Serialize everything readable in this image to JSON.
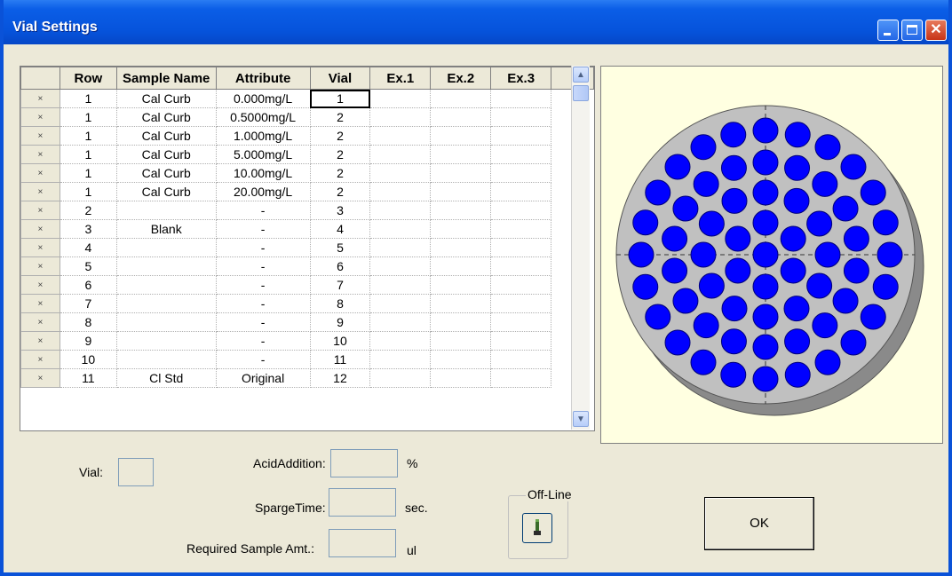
{
  "window": {
    "title": "Vial Settings"
  },
  "grid": {
    "columns": [
      "Row",
      "Sample Name",
      "Attribute",
      "Vial",
      "Ex.1",
      "Ex.2",
      "Ex.3"
    ],
    "row_marker": "×",
    "rows": [
      {
        "row": "1",
        "sample": "Cal Curb",
        "attr": "0.000mg/L",
        "vial": "1",
        "ex1": "",
        "ex2": "",
        "ex3": ""
      },
      {
        "row": "1",
        "sample": "Cal Curb",
        "attr": "0.5000mg/L",
        "vial": "2",
        "ex1": "",
        "ex2": "",
        "ex3": ""
      },
      {
        "row": "1",
        "sample": "Cal Curb",
        "attr": "1.000mg/L",
        "vial": "2",
        "ex1": "",
        "ex2": "",
        "ex3": ""
      },
      {
        "row": "1",
        "sample": "Cal Curb",
        "attr": "5.000mg/L",
        "vial": "2",
        "ex1": "",
        "ex2": "",
        "ex3": ""
      },
      {
        "row": "1",
        "sample": "Cal Curb",
        "attr": "10.00mg/L",
        "vial": "2",
        "ex1": "",
        "ex2": "",
        "ex3": ""
      },
      {
        "row": "1",
        "sample": "Cal Curb",
        "attr": "20.00mg/L",
        "vial": "2",
        "ex1": "",
        "ex2": "",
        "ex3": ""
      },
      {
        "row": "2",
        "sample": "",
        "attr": "-",
        "vial": "3",
        "ex1": "",
        "ex2": "",
        "ex3": ""
      },
      {
        "row": "3",
        "sample": "Blank",
        "attr": "-",
        "vial": "4",
        "ex1": "",
        "ex2": "",
        "ex3": ""
      },
      {
        "row": "4",
        "sample": "",
        "attr": "-",
        "vial": "5",
        "ex1": "",
        "ex2": "",
        "ex3": ""
      },
      {
        "row": "5",
        "sample": "",
        "attr": "-",
        "vial": "6",
        "ex1": "",
        "ex2": "",
        "ex3": ""
      },
      {
        "row": "6",
        "sample": "",
        "attr": "-",
        "vial": "7",
        "ex1": "",
        "ex2": "",
        "ex3": ""
      },
      {
        "row": "7",
        "sample": "",
        "attr": "-",
        "vial": "8",
        "ex1": "",
        "ex2": "",
        "ex3": ""
      },
      {
        "row": "8",
        "sample": "",
        "attr": "-",
        "vial": "9",
        "ex1": "",
        "ex2": "",
        "ex3": ""
      },
      {
        "row": "9",
        "sample": "",
        "attr": "-",
        "vial": "10",
        "ex1": "",
        "ex2": "",
        "ex3": ""
      },
      {
        "row": "10",
        "sample": "",
        "attr": "-",
        "vial": "11",
        "ex1": "",
        "ex2": "",
        "ex3": ""
      },
      {
        "row": "11",
        "sample": "Cl Std",
        "attr": "Original",
        "vial": "12",
        "ex1": "",
        "ex2": "",
        "ex3": ""
      }
    ]
  },
  "form": {
    "vial_label": "Vial:",
    "vial_value": "",
    "acid_label": "AcidAddition:",
    "acid_value": "",
    "acid_unit": "%",
    "sparge_label": "SpargeTime:",
    "sparge_value": "",
    "sparge_unit": "sec.",
    "sample_label": "Required Sample Amt.:",
    "sample_value": "",
    "sample_unit": "ul"
  },
  "offline": {
    "group_label": "Off-Line",
    "icon": "wrench-icon"
  },
  "ok_button": {
    "label": "OK"
  },
  "colors": {
    "titlebar": "#0653db",
    "panel_bg": "#ece9d8",
    "plate_bg": "#ffffe1",
    "plate_face": "#c0c0c0",
    "plate_side": "#8a8a8a",
    "vial_fill": "#0000ff",
    "vial_outline": "#00007a"
  }
}
